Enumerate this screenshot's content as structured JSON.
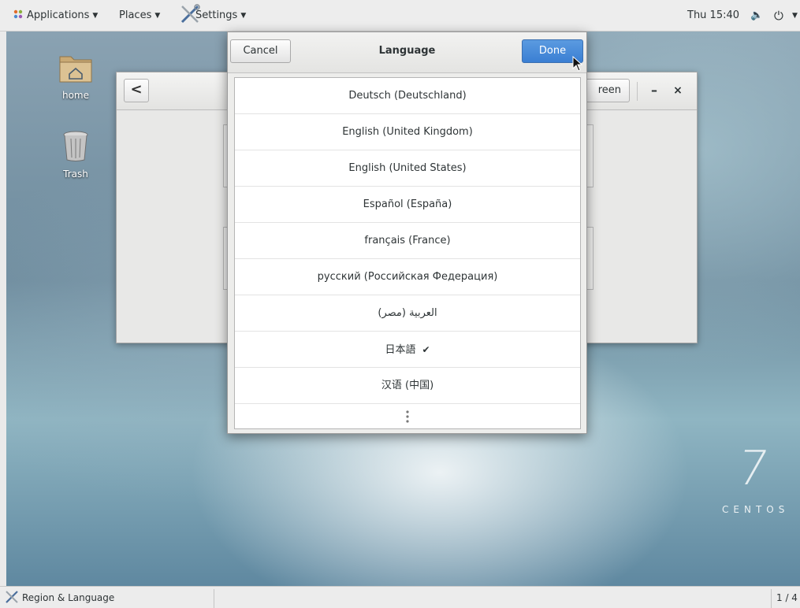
{
  "topbar": {
    "applications_label": "Applications",
    "places_label": "Places",
    "settings_label": "Settings",
    "clock": "Thu 15:40",
    "icons": [
      "apps-icon",
      "tools-icon",
      "volume-icon",
      "power-icon",
      "dropdown-arrow-icon"
    ]
  },
  "desktop": {
    "home_label": "home",
    "trash_label": "Trash",
    "centos_version": "7",
    "centos_wordmark": "CENTOS"
  },
  "settings_window": {
    "back_symbol": "<",
    "screen_button_partial": "reen",
    "minimize_symbol": "–",
    "close_symbol": "×"
  },
  "language_dialog": {
    "cancel_label": "Cancel",
    "title": "Language",
    "done_label": "Done",
    "selected_language": "日本語",
    "check_symbol": "✔",
    "languages": [
      "Deutsch (Deutschland)",
      "English (United Kingdom)",
      "English (United States)",
      "Español (España)",
      "français (France)",
      "русский (Российская Федерация)",
      "العربية (مصر)",
      "日本語",
      "汉语 (中国)"
    ]
  },
  "taskbar": {
    "task_label": "Region & Language",
    "workspace": "1 / 4"
  },
  "colors": {
    "done_button": "#3a7fd3",
    "topbar_bg": "#ededed",
    "dialog_bg": "#ededeb"
  }
}
